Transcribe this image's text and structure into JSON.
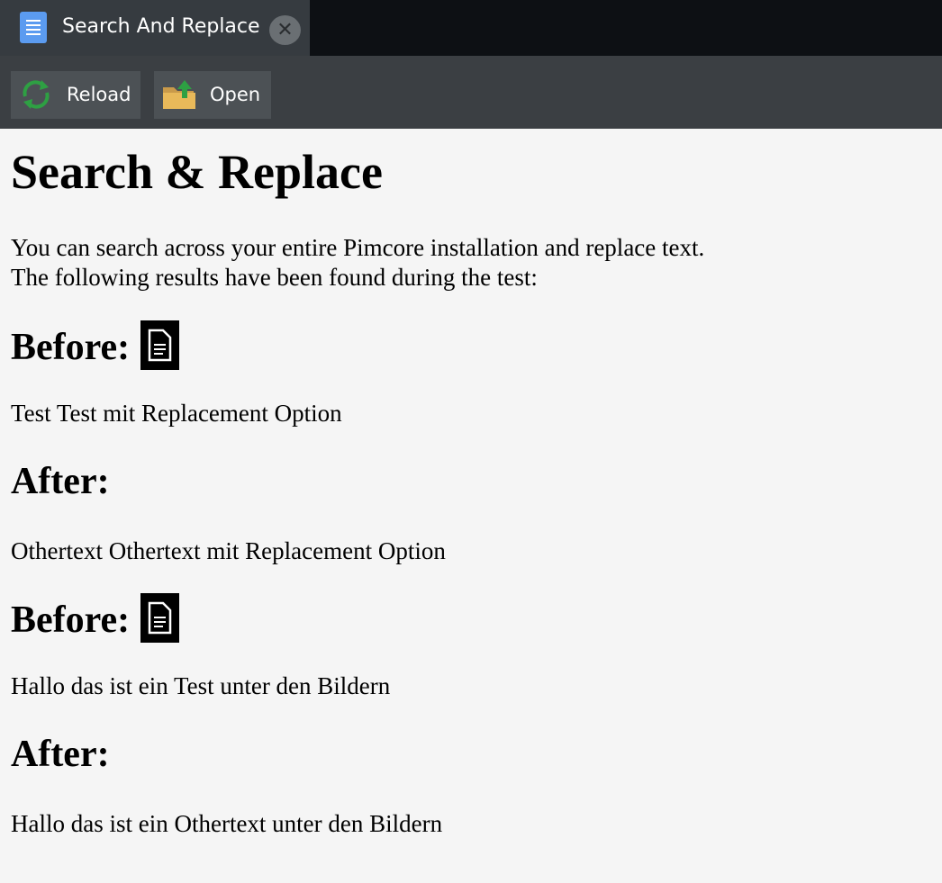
{
  "tab": {
    "title": "Search And Replace",
    "icon": "document-icon",
    "close_icon": "close-icon"
  },
  "toolbar": {
    "reload_label": "Reload",
    "open_label": "Open"
  },
  "page": {
    "heading": "Search & Replace",
    "intro_line1": "You can search across your entire Pimcore installation and replace text.",
    "intro_line2": "The following results have been found during the test:",
    "results": [
      {
        "before_label": "Before:",
        "before_text": "Test Test mit Replacement Option",
        "after_label": "After:",
        "after_text": "Othertext Othertext mit Replacement Option"
      },
      {
        "before_label": "Before:",
        "before_text": "Hallo das ist ein Test unter den Bildern",
        "after_label": "After:",
        "after_text": "Hallo das ist ein Othertext unter den Bildern"
      }
    ]
  },
  "colors": {
    "tabbar_bg": "#0d1014",
    "tab_bg": "#363b40",
    "toolbar_bg": "#3b3f43",
    "button_bg": "#4c5155",
    "content_bg": "#f5f5f5",
    "reload_green": "#2ea043",
    "folder_yellow": "#e8b95a",
    "tab_icon_blue": "#5b9bf0"
  }
}
